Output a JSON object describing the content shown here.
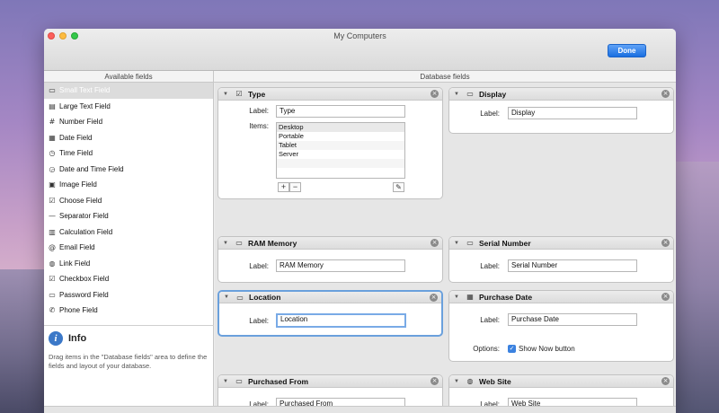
{
  "window": {
    "title": "My Computers",
    "done_label": "Done"
  },
  "columns": {
    "available": "Available fields",
    "database": "Database fields"
  },
  "available_fields": [
    {
      "label": "Small Text Field",
      "icon": "small-text-icon",
      "glyph": "▭"
    },
    {
      "label": "Large Text Field",
      "icon": "large-text-icon",
      "glyph": "▤"
    },
    {
      "label": "Number Field",
      "icon": "number-icon",
      "glyph": "#"
    },
    {
      "label": "Date Field",
      "icon": "calendar-icon",
      "glyph": "▦"
    },
    {
      "label": "Time Field",
      "icon": "clock-icon",
      "glyph": "◷"
    },
    {
      "label": "Date and Time Field",
      "icon": "datetime-icon",
      "glyph": "◶"
    },
    {
      "label": "Image Field",
      "icon": "image-icon",
      "glyph": "▣"
    },
    {
      "label": "Choose Field",
      "icon": "choose-icon",
      "glyph": "☑"
    },
    {
      "label": "Separator Field",
      "icon": "separator-icon",
      "glyph": "—"
    },
    {
      "label": "Calculation Field",
      "icon": "calculator-icon",
      "glyph": "▥"
    },
    {
      "label": "Email Field",
      "icon": "at-icon",
      "glyph": "@"
    },
    {
      "label": "Link Field",
      "icon": "globe-icon",
      "glyph": "◍"
    },
    {
      "label": "Checkbox Field",
      "icon": "checkbox-icon",
      "glyph": "☑"
    },
    {
      "label": "Password Field",
      "icon": "password-icon",
      "glyph": "▭"
    },
    {
      "label": "Phone Field",
      "icon": "phone-icon",
      "glyph": "✆"
    }
  ],
  "info": {
    "title": "Info",
    "text": "Drag items in the \"Database fields\" area to define the fields and layout of your database."
  },
  "cards": {
    "type": {
      "title": "Type",
      "label_caption": "Label:",
      "label_value": "Type",
      "items_caption": "Items:",
      "items": [
        "Desktop",
        "Portable",
        "Tablet",
        "Server"
      ],
      "add": "+",
      "remove": "−"
    },
    "display": {
      "title": "Display",
      "label_caption": "Label:",
      "label_value": "Display"
    },
    "ram": {
      "title": "RAM Memory",
      "label_caption": "Label:",
      "label_value": "RAM Memory"
    },
    "serial": {
      "title": "Serial Number",
      "label_caption": "Label:",
      "label_value": "Serial Number"
    },
    "location": {
      "title": "Location",
      "label_caption": "Label:",
      "label_value": "Location"
    },
    "purchase_date": {
      "title": "Purchase Date",
      "label_caption": "Label:",
      "label_value": "Purchase Date",
      "options_caption": "Options:",
      "option_label": "Show Now button",
      "option_checked": true
    },
    "purchased_from": {
      "title": "Purchased From",
      "label_caption": "Label:",
      "label_value": "Purchased From"
    },
    "web_site": {
      "title": "Web Site",
      "label_caption": "Label:",
      "label_value": "Web Site"
    }
  }
}
